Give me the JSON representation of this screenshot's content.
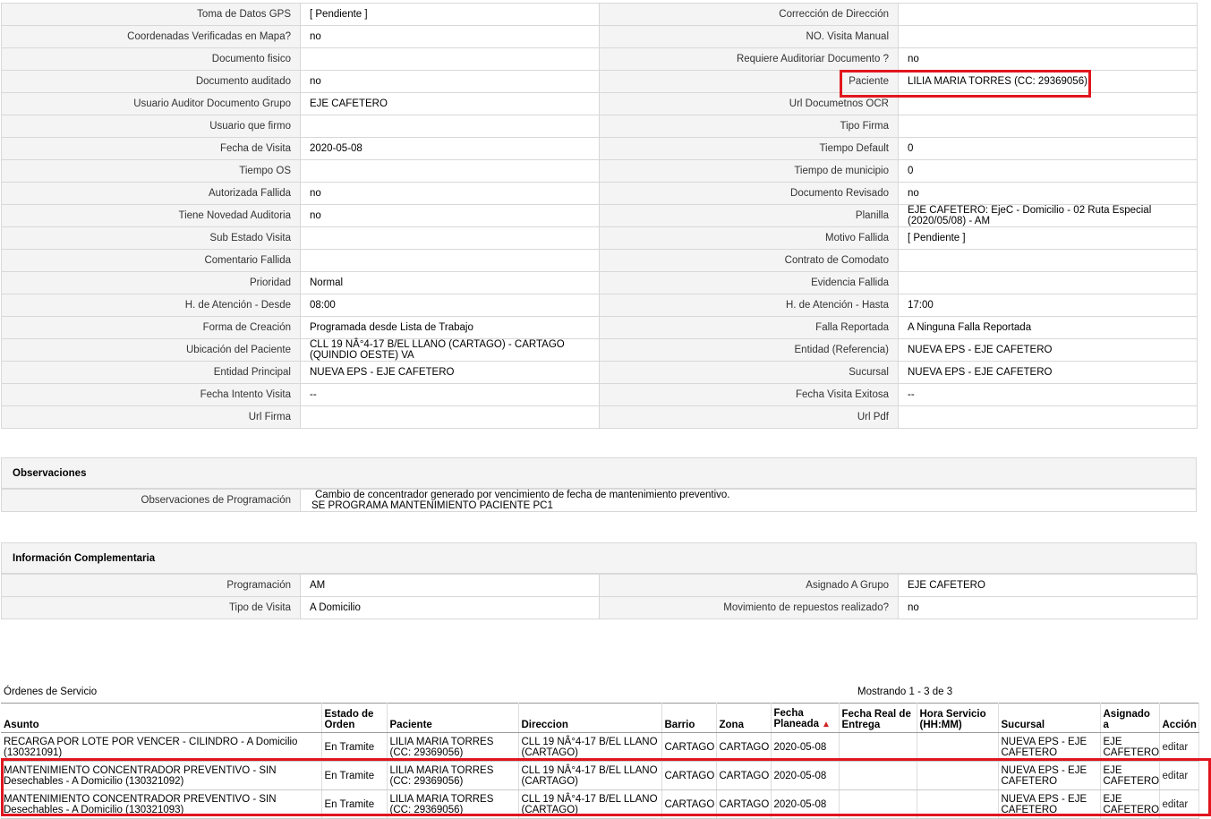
{
  "detail_rows": [
    [
      "Toma de Datos GPS",
      "[ Pendiente ]",
      "Corrección de Dirección",
      ""
    ],
    [
      "Coordenadas Verificadas en Mapa?",
      "no",
      "NO. Visita Manual",
      ""
    ],
    [
      "Documento fisico",
      "",
      "Requiere Auditoriar Documento ?",
      "no"
    ],
    [
      "Documento auditado",
      "no",
      "Paciente",
      "LILIA MARIA TORRES (CC: 29369056)"
    ],
    [
      "Usuario Auditor Documento Grupo",
      "EJE CAFETERO",
      "Url Documetnos OCR",
      ""
    ],
    [
      "Usuario que firmo",
      "",
      "Tipo Firma",
      ""
    ],
    [
      "Fecha de Visita",
      "2020-05-08",
      "Tiempo Default",
      "0"
    ],
    [
      "Tiempo OS",
      "",
      "Tiempo de municipio",
      "0"
    ],
    [
      "Autorizada Fallida",
      "no",
      "Documento Revisado",
      "no"
    ],
    [
      "Tiene Novedad Auditoria",
      "no",
      "Planilla",
      "EJE CAFETERO: EjeC - Domicilio - 02 Ruta Especial (2020/05/08) - AM"
    ],
    [
      "Sub Estado Visita",
      "",
      "Motivo Fallida",
      "[ Pendiente ]"
    ],
    [
      "Comentario Fallida",
      "",
      "Contrato de Comodato",
      ""
    ],
    [
      "Prioridad",
      "Normal",
      "Evidencia Fallida",
      ""
    ],
    [
      "H. de Atención - Desde",
      "08:00",
      "H. de Atención - Hasta",
      "17:00"
    ],
    [
      "Forma de Creación",
      "Programada desde Lista de Trabajo",
      "Falla Reportada",
      "A Ninguna Falla Reportada"
    ],
    [
      "Ubicación del Paciente",
      "CLL 19 NÂ°4-17 B/EL LLANO (CARTAGO) - CARTAGO (QUINDIO OESTE) VA",
      "Entidad (Referencia)",
      "NUEVA EPS - EJE CAFETERO"
    ],
    [
      "Entidad Principal",
      "NUEVA EPS - EJE CAFETERO",
      "Sucursal",
      "NUEVA EPS - EJE CAFETERO"
    ],
    [
      "Fecha Intento Visita",
      "--",
      "Fecha Visita Exitosa",
      "--"
    ],
    [
      "Url Firma",
      "",
      "Url Pdf",
      ""
    ]
  ],
  "observaciones": {
    "title": "Observaciones",
    "label": "Observaciones de Programación",
    "line1": "Cambio de concentrador generado por vencimiento de fecha de mantenimiento preventivo.",
    "line2": "SE PROGRAMA MANTENIMIENTO PACIENTE PC1"
  },
  "complementaria": {
    "title": "Información Complementaria",
    "rows": [
      [
        "Programación",
        "AM",
        "Asignado A Grupo",
        "EJE CAFETERO"
      ],
      [
        "Tipo de Visita",
        "A Domicilio",
        "Movimiento de repuestos realizado?",
        "no"
      ]
    ]
  },
  "orders": {
    "title": "Órdenes de Servicio",
    "count": "Mostrando 1 - 3 de 3",
    "headers": [
      "Asunto",
      "Estado de Orden",
      "Paciente",
      "Direccion",
      "Barrio",
      "Zona",
      "Fecha Planeada",
      "Fecha Real de Entrega",
      "Hora Servicio (HH:MM)",
      "Sucursal",
      "Asignado a",
      "Acción"
    ],
    "rows": [
      [
        "RECARGA POR LOTE POR VENCER - CILINDRO - A Domicilio (130321091)",
        "En Tramite",
        "LILIA MARIA TORRES (CC: 29369056)",
        "CLL 19 NÂ°4-17 B/EL LLANO (CARTAGO)",
        "CARTAGO",
        "CARTAGO",
        "2020-05-08",
        "",
        "",
        "NUEVA EPS - EJE CAFETERO",
        "EJE CAFETERO",
        "editar"
      ],
      [
        "MANTENIMIENTO CONCENTRADOR PREVENTIVO - SIN Desechables - A Domicilio (130321092)",
        "En Tramite",
        "LILIA MARIA TORRES (CC: 29369056)",
        "CLL 19 NÂ°4-17 B/EL LLANO (CARTAGO)",
        "CARTAGO",
        "CARTAGO",
        "2020-05-08",
        "",
        "",
        "NUEVA EPS - EJE CAFETERO",
        "EJE CAFETERO",
        "editar"
      ],
      [
        "MANTENIMIENTO CONCENTRADOR PREVENTIVO - SIN Desechables - A Domicilio (130321093)",
        "En Tramite",
        "LILIA MARIA TORRES (CC: 29369056)",
        "CLL 19 NÂ°4-17 B/EL LLANO (CARTAGO)",
        "CARTAGO",
        "CARTAGO",
        "2020-05-08",
        "",
        "",
        "NUEVA EPS - EJE CAFETERO",
        "EJE CAFETERO",
        "editar"
      ]
    ]
  },
  "highlight_color": "#e0161e",
  "sort_icon": "triangle-up-icon"
}
